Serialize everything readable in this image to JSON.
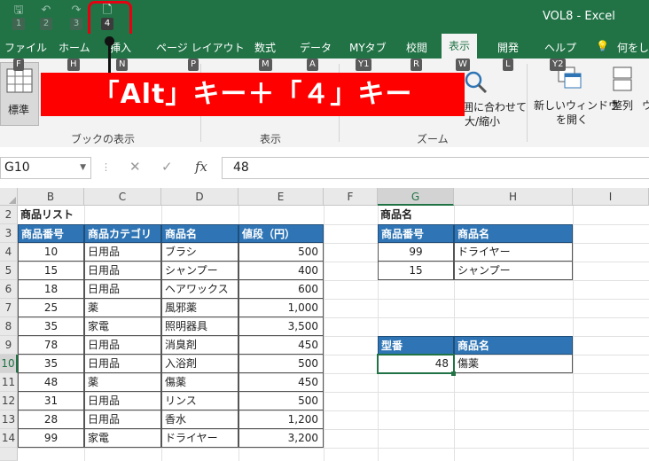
{
  "titlebar": {
    "window_title": "VOL8 - Excel",
    "qat": [
      {
        "glyph": "🖫",
        "badge": "1",
        "active": false
      },
      {
        "glyph": "↶",
        "badge": "2",
        "active": false
      },
      {
        "glyph": "↷",
        "badge": "3",
        "active": false
      },
      {
        "glyph": "🗋",
        "badge": "4",
        "active": true
      }
    ]
  },
  "tabs": [
    "ファイル",
    "ホーム",
    "挿入",
    "ページ レイアウト",
    "数式",
    "データ",
    "MYタブ",
    "校閲",
    "表示",
    "開発",
    "ヘルプ",
    "何をし"
  ],
  "active_tab": "表示",
  "key_tips": [
    "F",
    "H",
    "N",
    "P",
    "M",
    "A",
    "Y1",
    "R",
    "W",
    "L",
    "Y2"
  ],
  "ribbon": {
    "standard_view": "標準",
    "group_book_view": "ブックの表示",
    "group_show": "表示",
    "group_zoom": "ズーム",
    "zoom_fit_line1": "囲に合わせて",
    "zoom_fit_line2": "大/縮小",
    "new_window_line1": "新しいウィンドウ",
    "new_window_line2": "を開く",
    "arrange": "整列",
    "overflow": "ウ"
  },
  "banner_text": "「Alt」キー＋「４」キー",
  "formula_bar": {
    "name_box": "G10",
    "cancel_icon": "✕",
    "enter_icon": "✓",
    "fx_label": "fx",
    "value": "48"
  },
  "sheet": {
    "columns": [
      "B",
      "C",
      "D",
      "E",
      "F",
      "G",
      "H",
      "I"
    ],
    "rows": [
      "2",
      "3",
      "4",
      "5",
      "6",
      "7",
      "8",
      "9",
      "10",
      "11",
      "12",
      "13",
      "14"
    ],
    "list_title": "商品リスト",
    "list_headers": [
      "商品番号",
      "商品カテゴリ",
      "商品名",
      "値段（円）"
    ],
    "list_rows": [
      [
        "10",
        "日用品",
        "ブラシ",
        "500"
      ],
      [
        "15",
        "日用品",
        "シャンプー",
        "400"
      ],
      [
        "18",
        "日用品",
        "ヘアワックス",
        "600"
      ],
      [
        "25",
        "薬",
        "風邪薬",
        "1,000"
      ],
      [
        "35",
        "家電",
        "照明器具",
        "3,500"
      ],
      [
        "78",
        "日用品",
        "消臭剤",
        "450"
      ],
      [
        "35",
        "日用品",
        "入浴剤",
        "500"
      ],
      [
        "48",
        "薬",
        "傷薬",
        "450"
      ],
      [
        "31",
        "日用品",
        "リンス",
        "500"
      ],
      [
        "28",
        "日用品",
        "香水",
        "1,200"
      ],
      [
        "99",
        "家電",
        "ドライヤー",
        "3,200"
      ]
    ],
    "lookup_title": "商品名",
    "lookup_headers": [
      "商品番号",
      "商品名"
    ],
    "lookup_rows": [
      [
        "99",
        "ドライヤー"
      ],
      [
        "15",
        "シャンプー"
      ]
    ],
    "model_headers": [
      "型番",
      "商品名"
    ],
    "model_row": [
      "48",
      "傷薬"
    ]
  }
}
